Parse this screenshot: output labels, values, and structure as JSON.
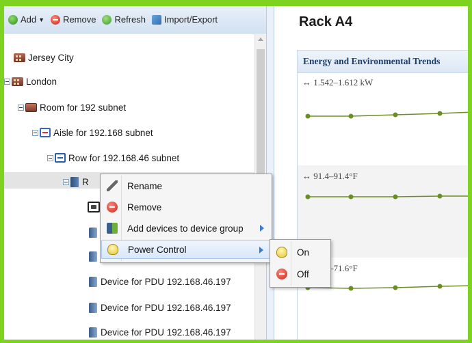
{
  "toolbar": {
    "add_label": "Add",
    "remove_label": "Remove",
    "refresh_label": "Refresh",
    "import_export_label": "Import/Export"
  },
  "tree": {
    "site_1": "Jersey City",
    "site_2": "London",
    "room": "Room for 192 subnet",
    "aisle": "Aisle for 192.168 subnet",
    "row": "Row for 192.168.46 subnet",
    "rack": "R",
    "devices": [
      "Device for PDU 192.168.46.197",
      "Device for PDU 192.168.46.197",
      "Device for PDU 192.168.46.197"
    ]
  },
  "context_menu": {
    "items": [
      "Rename",
      "Remove",
      "Add devices to device group",
      "Power Control"
    ]
  },
  "submenu": {
    "items": [
      "On",
      "Off"
    ]
  },
  "right_panel": {
    "title": "Rack A4",
    "chart_header": "Energy and Environmental Trends",
    "band_1_label": "↔ 1.542–1.612 kW",
    "band_2_label": "↔ 91.4–91.4°F",
    "band_3_label": "↔ 71.6–71.6°F"
  },
  "colors": {
    "accent_green": "#7ed321",
    "trend_point": "#6b8e23",
    "highlight": "#d8e7fa"
  }
}
